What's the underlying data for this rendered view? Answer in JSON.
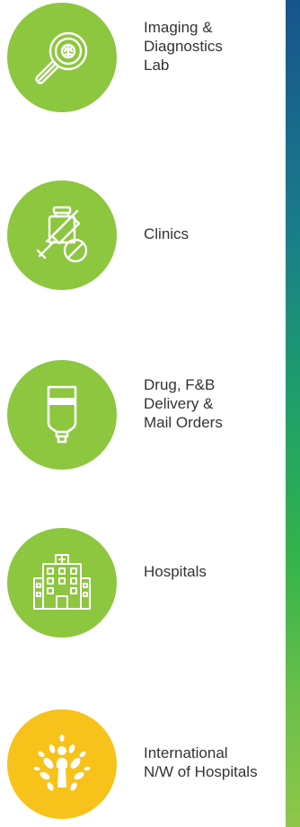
{
  "services": [
    {
      "label": "Imaging &\nDiagnostics\nLab",
      "icon": "magnifier-brain-icon",
      "color": "#8dc63f"
    },
    {
      "label": "Clinics",
      "icon": "syringe-vial-icon",
      "color": "#8dc63f"
    },
    {
      "label": "Drug, F&B\nDelivery &\nMail Orders",
      "icon": "iv-bag-icon",
      "color": "#8dc63f"
    },
    {
      "label": "Hospitals",
      "icon": "hospital-building-icon",
      "color": "#8dc63f"
    },
    {
      "label": "International\nN/W of Hospitals",
      "icon": "network-tree-icon",
      "color": "#f7c31a"
    }
  ],
  "accent_stripe": [
    "#17548c",
    "#1e9f6a",
    "#8fc64a"
  ]
}
